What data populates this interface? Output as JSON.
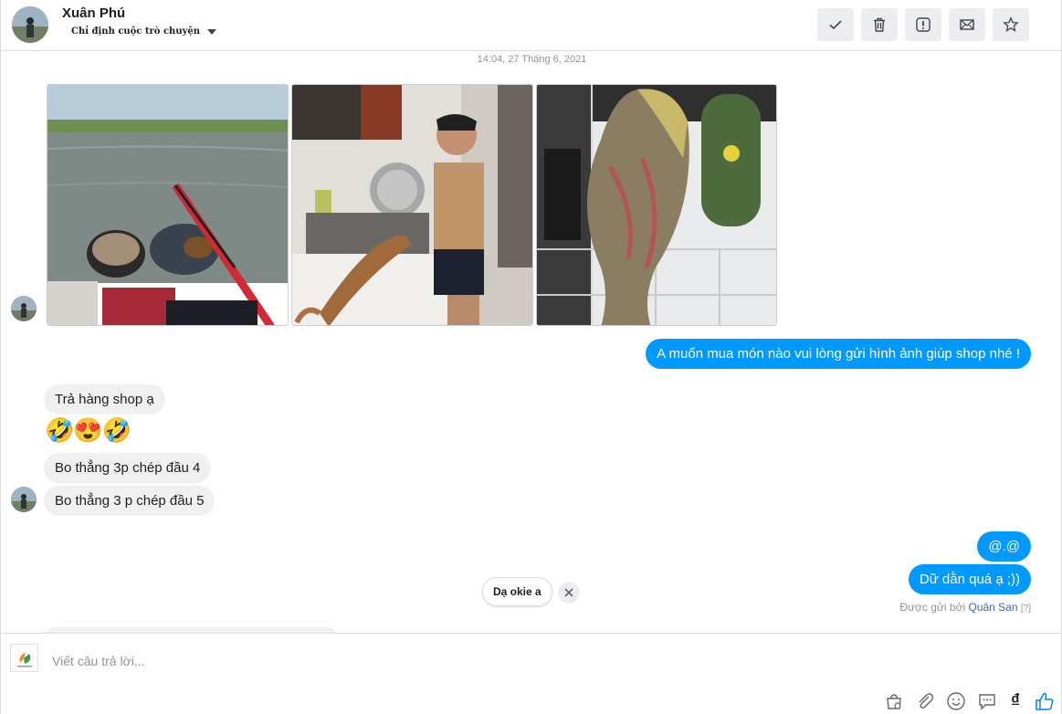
{
  "header": {
    "name": "Xuân Phú",
    "assign_label": "Chỉ định cuộc trò chuyện",
    "actions": [
      {
        "name": "mark-done",
        "icon": "check-icon"
      },
      {
        "name": "delete",
        "icon": "trash-icon"
      },
      {
        "name": "report-spam",
        "icon": "alert-icon"
      },
      {
        "name": "mark-unread",
        "icon": "envelope-icon"
      },
      {
        "name": "star",
        "icon": "star-icon"
      }
    ]
  },
  "thread": {
    "timestamp": "14:04, 27 Tháng 6, 2021",
    "photos": [
      {
        "name": "photo-fishing-lake",
        "icon": "photo-lake"
      },
      {
        "name": "photo-man-cleaning-fish",
        "icon": "photo-kitchen"
      },
      {
        "name": "photo-fish-closeup",
        "icon": "photo-fish"
      }
    ],
    "out_msg_1": "A muốn mua món nào vui lòng gửi hình ảnh giúp shop nhé !",
    "in_msg_1": "Trả hàng shop ạ",
    "emojis": "🤣😍🤣",
    "in_msg_2": "Bo thẳng 3p chép đầu 4",
    "in_msg_3": "Bo thẳng 3 p chép đầu 5",
    "out_msg_2": "@.@",
    "out_msg_3": "Dữ dằn quá ạ ;))",
    "sent_by_prefix": "Được gửi bởi",
    "sent_by_name": "Quân San",
    "sent_by_help": "[?]"
  },
  "quick_reply": {
    "label": "Dạ okie a"
  },
  "composer": {
    "placeholder": "Viết câu trả lời...",
    "currency_symbol": "₫"
  },
  "colors": {
    "outgoing_bubble": "#0099ff",
    "incoming_bubble": "#f1f0f0",
    "link": "#4267b2",
    "like": "#0084ff"
  }
}
